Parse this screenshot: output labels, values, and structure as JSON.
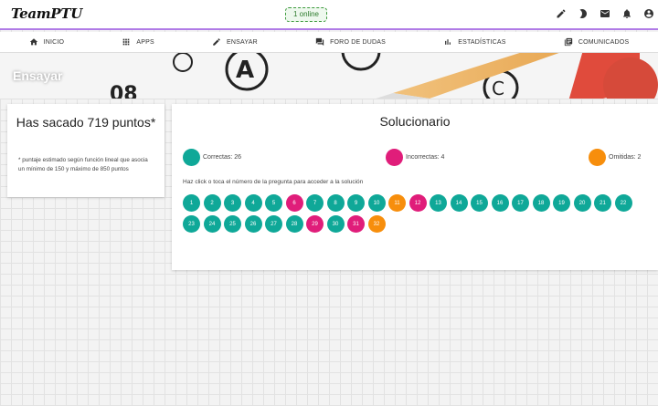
{
  "app": {
    "logo": "TeamPTU",
    "online_status": "1 online"
  },
  "colors": {
    "correct": "#0fa898",
    "incorrect": "#e01d7a",
    "omitted": "#f78e0c",
    "accent": "#b07be6"
  },
  "topbar": {
    "icons": [
      "edit-icon",
      "dark-mode-icon",
      "mail-icon",
      "bell-icon",
      "account-icon"
    ]
  },
  "nav": {
    "items": [
      {
        "label": "INICIO",
        "icon": "home-icon"
      },
      {
        "label": "APPS",
        "icon": "apps-icon"
      },
      {
        "label": "ENSAYAR",
        "icon": "edit-icon"
      },
      {
        "label": "FORO DE DUDAS",
        "icon": "forum-icon"
      },
      {
        "label": "ESTADÍSTICAS",
        "icon": "bar-chart-icon"
      },
      {
        "label": "COMUNICADOS",
        "icon": "library-icon"
      }
    ]
  },
  "banner": {
    "title": "Ensayar"
  },
  "score": {
    "title": "Has sacado 719 puntos*",
    "note": "* puntaje estimado según función lineal que asocia un mínimo de 150 y máximo de 850 puntos"
  },
  "solucionario": {
    "title": "Solucionario",
    "legend": {
      "correct": "Correctas: 26",
      "incorrect": "Incorrectas: 4",
      "omitted": "Omitidas: 2"
    },
    "instruction": "Haz click o toca el número de la pregunta para acceder a la solución",
    "questions": [
      {
        "n": "1",
        "status": "correct"
      },
      {
        "n": "2",
        "status": "correct"
      },
      {
        "n": "3",
        "status": "correct"
      },
      {
        "n": "4",
        "status": "correct"
      },
      {
        "n": "5",
        "status": "correct"
      },
      {
        "n": "6",
        "status": "incorrect"
      },
      {
        "n": "7",
        "status": "correct"
      },
      {
        "n": "8",
        "status": "correct"
      },
      {
        "n": "9",
        "status": "correct"
      },
      {
        "n": "10",
        "status": "correct"
      },
      {
        "n": "11",
        "status": "omitted"
      },
      {
        "n": "12",
        "status": "incorrect"
      },
      {
        "n": "13",
        "status": "correct"
      },
      {
        "n": "14",
        "status": "correct"
      },
      {
        "n": "15",
        "status": "correct"
      },
      {
        "n": "16",
        "status": "correct"
      },
      {
        "n": "17",
        "status": "correct"
      },
      {
        "n": "18",
        "status": "correct"
      },
      {
        "n": "19",
        "status": "correct"
      },
      {
        "n": "20",
        "status": "correct"
      },
      {
        "n": "21",
        "status": "correct"
      },
      {
        "n": "22",
        "status": "correct"
      },
      {
        "n": "23",
        "status": "correct"
      },
      {
        "n": "24",
        "status": "correct"
      },
      {
        "n": "25",
        "status": "correct"
      },
      {
        "n": "26",
        "status": "correct"
      },
      {
        "n": "27",
        "status": "correct"
      },
      {
        "n": "28",
        "status": "correct"
      },
      {
        "n": "29",
        "status": "incorrect"
      },
      {
        "n": "30",
        "status": "correct"
      },
      {
        "n": "31",
        "status": "incorrect"
      },
      {
        "n": "32",
        "status": "omitted"
      }
    ]
  }
}
